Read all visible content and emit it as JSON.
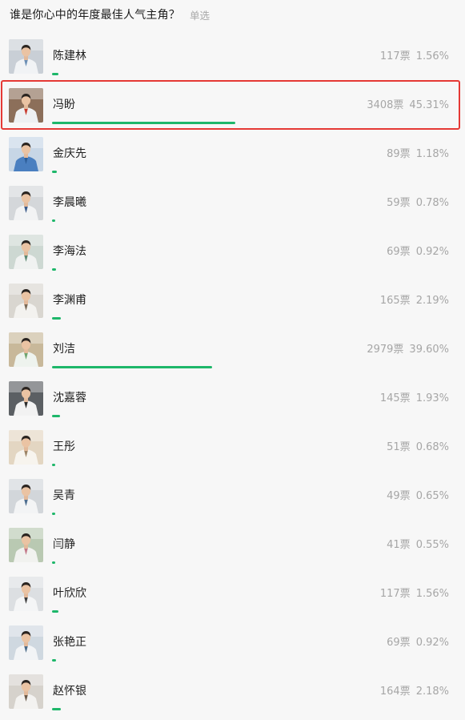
{
  "poll": {
    "title": "谁是你心中的年度最佳人气主角？",
    "type_label": "单选",
    "options": [
      {
        "name": "陈建林",
        "votes": "117票",
        "percent": "1.56%",
        "share": 0.0156,
        "avatar": "doctor-photo",
        "avatar_bg": "#c9cfd6",
        "coat": "#f1f3f5",
        "accent": "#6b8fb5",
        "highlighted": false
      },
      {
        "name": "冯盼",
        "votes": "3408票",
        "percent": "45.31%",
        "share": 0.4531,
        "avatar": "doctor-photo",
        "avatar_bg": "#8c6f5a",
        "coat": "#eef0f2",
        "accent": "#c83a2e",
        "highlighted": true
      },
      {
        "name": "金庆先",
        "votes": "89票",
        "percent": "1.18%",
        "share": 0.0118,
        "avatar": "doctor-photo",
        "avatar_bg": "#c7d6e6",
        "coat": "#4a7fc0",
        "accent": "#2e5f99",
        "highlighted": false
      },
      {
        "name": "李晨曦",
        "votes": "59票",
        "percent": "0.78%",
        "share": 0.0078,
        "avatar": "doctor-photo",
        "avatar_bg": "#d4d7da",
        "coat": "#f2f3f4",
        "accent": "#3a5a8a",
        "highlighted": false
      },
      {
        "name": "李海法",
        "votes": "69票",
        "percent": "0.92%",
        "share": 0.0092,
        "avatar": "doctor-photo",
        "avatar_bg": "#cdd8d2",
        "coat": "#f0f2f1",
        "accent": "#5e8a74",
        "highlighted": false
      },
      {
        "name": "李渊甫",
        "votes": "165票",
        "percent": "2.19%",
        "share": 0.0219,
        "avatar": "doctor-photo",
        "avatar_bg": "#d9d6d0",
        "coat": "#f3f2ef",
        "accent": "#7a6a58",
        "highlighted": false
      },
      {
        "name": "刘洁",
        "votes": "2979票",
        "percent": "39.60%",
        "share": 0.396,
        "avatar": "doctor-photo",
        "avatar_bg": "#c8b89a",
        "coat": "#eef3ee",
        "accent": "#6fa46f",
        "highlighted": false
      },
      {
        "name": "沈嘉蓉",
        "votes": "145票",
        "percent": "1.93%",
        "share": 0.0193,
        "avatar": "doctor-photo",
        "avatar_bg": "#5b5f63",
        "coat": "#f2f2f2",
        "accent": "#2b2b2b",
        "highlighted": false
      },
      {
        "name": "王彤",
        "votes": "51票",
        "percent": "0.68%",
        "share": 0.0068,
        "avatar": "doctor-photo",
        "avatar_bg": "#e3d6c2",
        "coat": "#f7f4ee",
        "accent": "#9c8466",
        "highlighted": false
      },
      {
        "name": "吴青",
        "votes": "49票",
        "percent": "0.65%",
        "share": 0.0065,
        "avatar": "doctor-photo",
        "avatar_bg": "#d2d6da",
        "coat": "#f3f4f5",
        "accent": "#4d6d8f",
        "highlighted": false
      },
      {
        "name": "闫静",
        "votes": "41票",
        "percent": "0.55%",
        "share": 0.0055,
        "avatar": "doctor-photo",
        "avatar_bg": "#b9c9b2",
        "coat": "#f1f2ef",
        "accent": "#c47a8a",
        "highlighted": false
      },
      {
        "name": "叶欣欣",
        "votes": "117票",
        "percent": "1.56%",
        "share": 0.0156,
        "avatar": "doctor-photo",
        "avatar_bg": "#dcdfe2",
        "coat": "#f4f5f6",
        "accent": "#3d3d3d",
        "highlighted": false
      },
      {
        "name": "张艳正",
        "votes": "69票",
        "percent": "0.92%",
        "share": 0.0092,
        "avatar": "doctor-photo",
        "avatar_bg": "#cfd8e0",
        "coat": "#f2f4f6",
        "accent": "#4a6a88",
        "highlighted": false
      },
      {
        "name": "赵怀银",
        "votes": "164票",
        "percent": "2.18%",
        "share": 0.0218,
        "avatar": "doctor-photo",
        "avatar_bg": "#d6d2cc",
        "coat": "#f3f2f0",
        "accent": "#6a5a4a",
        "highlighted": false
      }
    ]
  },
  "colors": {
    "bar": "#1eb76a",
    "highlight_border": "#e53935",
    "muted_text": "#a6a6a6"
  }
}
